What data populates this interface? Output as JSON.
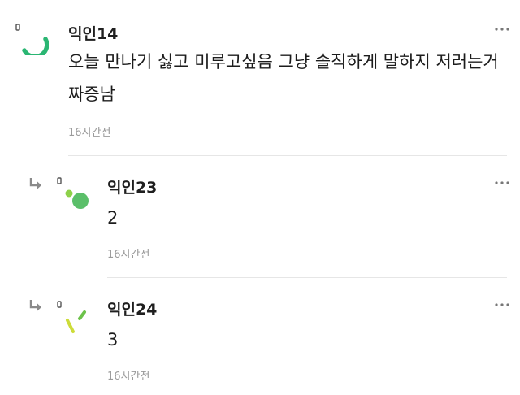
{
  "comments": [
    {
      "author": "익인14",
      "body": "오늘 만나기 싫고 미루고싶음 그냥 솔직하게 말하지 저러는거 짜증남",
      "time": "16시간전",
      "more_icon": "more-horizontal-icon",
      "avatar_icon": "arc-avatar-icon",
      "avatar_color": "#2bb673"
    },
    {
      "author": "익인23",
      "body": "2",
      "time": "16시간전",
      "more_icon": "more-horizontal-icon",
      "reply_icon": "reply-arrow-icon",
      "avatar_icon": "dots-avatar-icon",
      "avatar_color": "#5bbf6a",
      "avatar_accent": "#8ed14a"
    },
    {
      "author": "익인24",
      "body": "3",
      "time": "16시간전",
      "more_icon": "more-horizontal-icon",
      "reply_icon": "reply-arrow-icon",
      "avatar_icon": "dashes-avatar-icon",
      "avatar_color": "#6cc24a",
      "avatar_accent": "#cddc39"
    }
  ]
}
